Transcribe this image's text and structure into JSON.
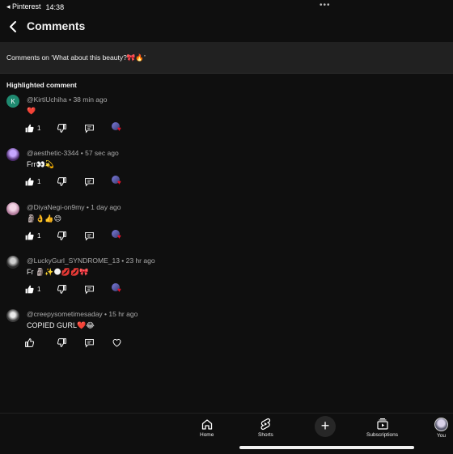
{
  "status_bar": {
    "app_label": "◂ Pinterest",
    "time": "14:38",
    "dots": "•••"
  },
  "header": {
    "title": "Comments"
  },
  "context": {
    "text": "Comments on ‘What about this beauty?🎀🔥’"
  },
  "section": {
    "label": "Highlighted comment"
  },
  "comments": [
    {
      "avatar_letter": "K",
      "author": "@KirtiUchiha",
      "time": "38 min ago",
      "text": "❤️",
      "likes": "1"
    },
    {
      "avatar_letter": "",
      "author": "@aesthetic-3344",
      "time": "57 sec ago",
      "text": "Frr👀💫",
      "likes": "1"
    },
    {
      "avatar_letter": "",
      "author": "@DiyaNegi-on9my",
      "time": "1 day ago",
      "text": "🗿👌👍😊",
      "likes": "1"
    },
    {
      "avatar_letter": "",
      "author": "@LuckyGurl_SYNDROME_13",
      "time": "23 hr ago",
      "text": "Fr 🗿✨🌑💋💋🎀",
      "likes": "1"
    },
    {
      "avatar_letter": "",
      "author": "@creepysometimesaday",
      "time": "15 hr ago",
      "text": "COPIED GURL❤️😂",
      "likes": ""
    }
  ],
  "comment_meta_separator": " • ",
  "nav": {
    "home": "Home",
    "shorts": "Shorts",
    "create": "+",
    "subscriptions": "Subscriptions",
    "you": "You"
  },
  "colors": {
    "background": "#0f0f0f",
    "panel": "#212121",
    "heart": "#e0102a",
    "muted_text": "#aaaaaa"
  }
}
